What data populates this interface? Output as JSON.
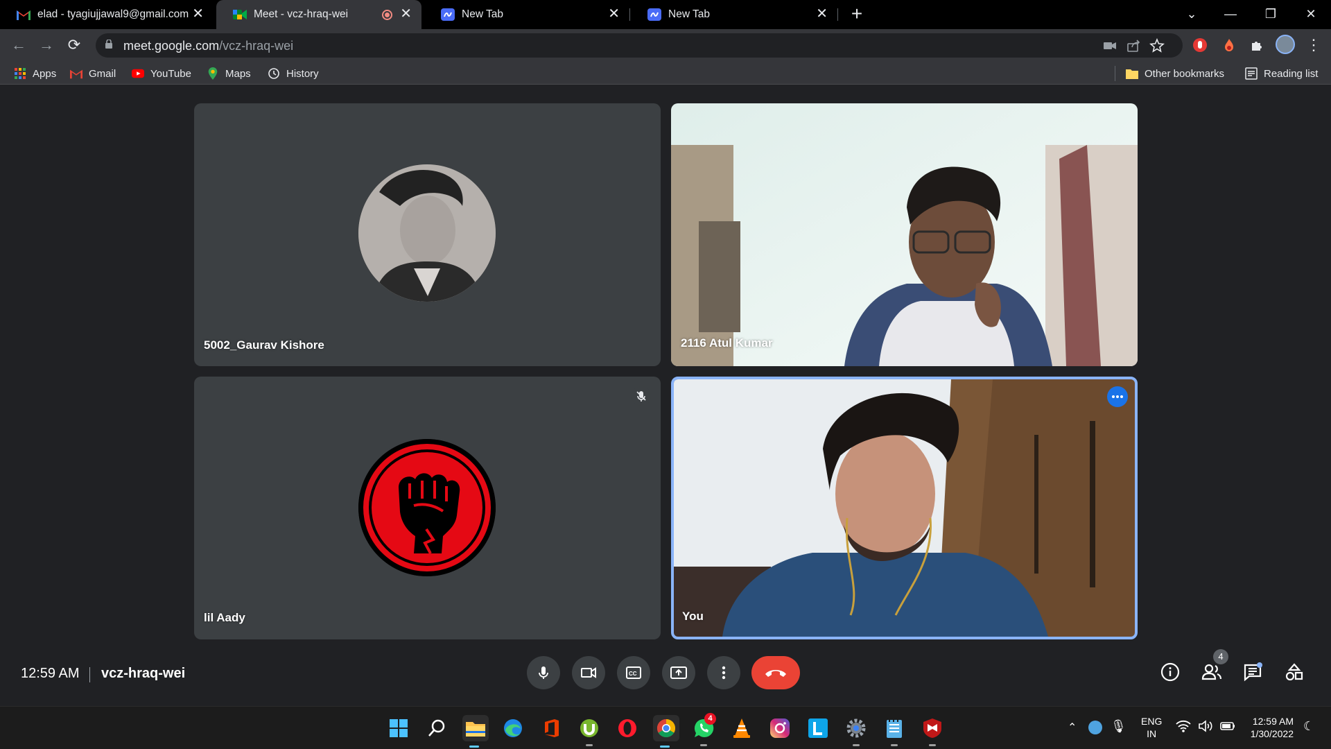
{
  "browser": {
    "tabs": [
      {
        "title": "elad - tyagiujjawal9@gmail.com",
        "favicon": "gmail-icon",
        "active": false
      },
      {
        "title": "Meet - vcz-hraq-wei",
        "favicon": "google-meet-icon",
        "active": true,
        "recording": true
      },
      {
        "title": "New Tab",
        "favicon": "new-tab-icon",
        "active": false
      },
      {
        "title": "New Tab",
        "favicon": "new-tab-icon",
        "active": false
      }
    ],
    "url_host": "meet.google.com",
    "url_path": "/vcz-hraq-wei",
    "bookmarks": [
      {
        "label": "Apps",
        "icon": "apps-grid-icon"
      },
      {
        "label": "Gmail",
        "icon": "gmail-icon"
      },
      {
        "label": "YouTube",
        "icon": "youtube-icon"
      },
      {
        "label": "Maps",
        "icon": "maps-pin-icon"
      },
      {
        "label": "History",
        "icon": "history-icon"
      }
    ],
    "other_bookmarks": "Other bookmarks",
    "reading_list": "Reading list"
  },
  "meet": {
    "tiles": [
      {
        "name": "5002_Gaurav Kishore",
        "type": "avatar-photo"
      },
      {
        "name": "2116 Atul Kumar",
        "type": "video"
      },
      {
        "name": "lil Aady",
        "type": "avatar-logo",
        "muted": true
      },
      {
        "name": "You",
        "type": "video",
        "active_speaker": true
      }
    ],
    "time": "12:59 AM",
    "meeting_code": "vcz-hraq-wei",
    "controls": [
      "microphone-icon",
      "camera-icon",
      "captions-icon",
      "present-icon",
      "more-options-icon",
      "end-call-icon"
    ],
    "side_controls": [
      "info-icon",
      "people-icon",
      "chat-icon",
      "activities-icon"
    ],
    "participant_count": "4"
  },
  "taskbar": {
    "apps": [
      "windows-start-icon",
      "search-icon",
      "file-explorer-icon",
      "edge-icon",
      "office-icon",
      "utorrent-icon",
      "opera-icon",
      "chrome-icon",
      "whatsapp-icon",
      "vlc-icon",
      "instagram-icon",
      "l-app-icon",
      "settings-icon",
      "notepad-icon",
      "mcafee-icon"
    ],
    "whatsapp_badge": "4",
    "lang_top": "ENG",
    "lang_bottom": "IN",
    "clock_time": "12:59 AM",
    "clock_date": "1/30/2022"
  },
  "colors": {
    "meet_bg": "#202124",
    "tile_bg": "#3c4043",
    "end_call": "#ea4335",
    "active_speaker_border": "#8ab4f8",
    "accent_blue": "#1a73e8"
  }
}
